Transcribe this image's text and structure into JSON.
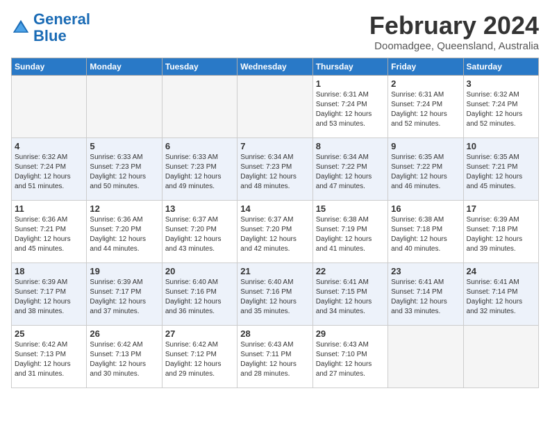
{
  "header": {
    "logo_line1": "General",
    "logo_line2": "Blue",
    "month_title": "February 2024",
    "location": "Doomadgee, Queensland, Australia"
  },
  "days_of_week": [
    "Sunday",
    "Monday",
    "Tuesday",
    "Wednesday",
    "Thursday",
    "Friday",
    "Saturday"
  ],
  "weeks": [
    [
      {
        "day": "",
        "info": ""
      },
      {
        "day": "",
        "info": ""
      },
      {
        "day": "",
        "info": ""
      },
      {
        "day": "",
        "info": ""
      },
      {
        "day": "1",
        "info": "Sunrise: 6:31 AM\nSunset: 7:24 PM\nDaylight: 12 hours\nand 53 minutes."
      },
      {
        "day": "2",
        "info": "Sunrise: 6:31 AM\nSunset: 7:24 PM\nDaylight: 12 hours\nand 52 minutes."
      },
      {
        "day": "3",
        "info": "Sunrise: 6:32 AM\nSunset: 7:24 PM\nDaylight: 12 hours\nand 52 minutes."
      }
    ],
    [
      {
        "day": "4",
        "info": "Sunrise: 6:32 AM\nSunset: 7:24 PM\nDaylight: 12 hours\nand 51 minutes."
      },
      {
        "day": "5",
        "info": "Sunrise: 6:33 AM\nSunset: 7:23 PM\nDaylight: 12 hours\nand 50 minutes."
      },
      {
        "day": "6",
        "info": "Sunrise: 6:33 AM\nSunset: 7:23 PM\nDaylight: 12 hours\nand 49 minutes."
      },
      {
        "day": "7",
        "info": "Sunrise: 6:34 AM\nSunset: 7:23 PM\nDaylight: 12 hours\nand 48 minutes."
      },
      {
        "day": "8",
        "info": "Sunrise: 6:34 AM\nSunset: 7:22 PM\nDaylight: 12 hours\nand 47 minutes."
      },
      {
        "day": "9",
        "info": "Sunrise: 6:35 AM\nSunset: 7:22 PM\nDaylight: 12 hours\nand 46 minutes."
      },
      {
        "day": "10",
        "info": "Sunrise: 6:35 AM\nSunset: 7:21 PM\nDaylight: 12 hours\nand 45 minutes."
      }
    ],
    [
      {
        "day": "11",
        "info": "Sunrise: 6:36 AM\nSunset: 7:21 PM\nDaylight: 12 hours\nand 45 minutes."
      },
      {
        "day": "12",
        "info": "Sunrise: 6:36 AM\nSunset: 7:20 PM\nDaylight: 12 hours\nand 44 minutes."
      },
      {
        "day": "13",
        "info": "Sunrise: 6:37 AM\nSunset: 7:20 PM\nDaylight: 12 hours\nand 43 minutes."
      },
      {
        "day": "14",
        "info": "Sunrise: 6:37 AM\nSunset: 7:20 PM\nDaylight: 12 hours\nand 42 minutes."
      },
      {
        "day": "15",
        "info": "Sunrise: 6:38 AM\nSunset: 7:19 PM\nDaylight: 12 hours\nand 41 minutes."
      },
      {
        "day": "16",
        "info": "Sunrise: 6:38 AM\nSunset: 7:18 PM\nDaylight: 12 hours\nand 40 minutes."
      },
      {
        "day": "17",
        "info": "Sunrise: 6:39 AM\nSunset: 7:18 PM\nDaylight: 12 hours\nand 39 minutes."
      }
    ],
    [
      {
        "day": "18",
        "info": "Sunrise: 6:39 AM\nSunset: 7:17 PM\nDaylight: 12 hours\nand 38 minutes."
      },
      {
        "day": "19",
        "info": "Sunrise: 6:39 AM\nSunset: 7:17 PM\nDaylight: 12 hours\nand 37 minutes."
      },
      {
        "day": "20",
        "info": "Sunrise: 6:40 AM\nSunset: 7:16 PM\nDaylight: 12 hours\nand 36 minutes."
      },
      {
        "day": "21",
        "info": "Sunrise: 6:40 AM\nSunset: 7:16 PM\nDaylight: 12 hours\nand 35 minutes."
      },
      {
        "day": "22",
        "info": "Sunrise: 6:41 AM\nSunset: 7:15 PM\nDaylight: 12 hours\nand 34 minutes."
      },
      {
        "day": "23",
        "info": "Sunrise: 6:41 AM\nSunset: 7:14 PM\nDaylight: 12 hours\nand 33 minutes."
      },
      {
        "day": "24",
        "info": "Sunrise: 6:41 AM\nSunset: 7:14 PM\nDaylight: 12 hours\nand 32 minutes."
      }
    ],
    [
      {
        "day": "25",
        "info": "Sunrise: 6:42 AM\nSunset: 7:13 PM\nDaylight: 12 hours\nand 31 minutes."
      },
      {
        "day": "26",
        "info": "Sunrise: 6:42 AM\nSunset: 7:13 PM\nDaylight: 12 hours\nand 30 minutes."
      },
      {
        "day": "27",
        "info": "Sunrise: 6:42 AM\nSunset: 7:12 PM\nDaylight: 12 hours\nand 29 minutes."
      },
      {
        "day": "28",
        "info": "Sunrise: 6:43 AM\nSunset: 7:11 PM\nDaylight: 12 hours\nand 28 minutes."
      },
      {
        "day": "29",
        "info": "Sunrise: 6:43 AM\nSunset: 7:10 PM\nDaylight: 12 hours\nand 27 minutes."
      },
      {
        "day": "",
        "info": ""
      },
      {
        "day": "",
        "info": ""
      }
    ]
  ]
}
